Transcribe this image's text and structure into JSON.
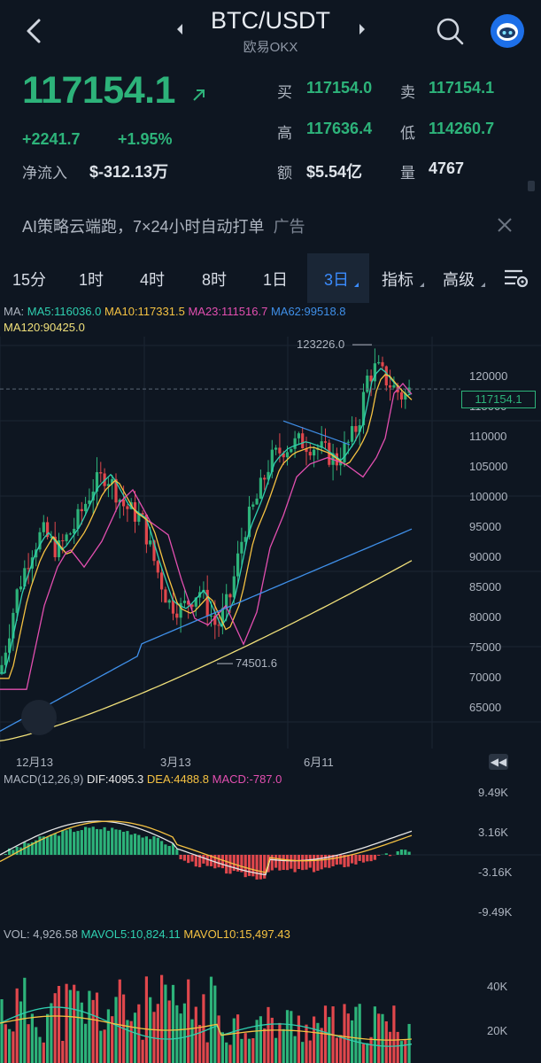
{
  "header": {
    "pair": "BTC/USDT",
    "exchange": "欧易OKX"
  },
  "ticker": {
    "price": "117154.1",
    "change_abs": "+2241.7",
    "change_pct": "+1.95%",
    "net_inflow_label": "净流入",
    "net_inflow_value": "$-312.13万",
    "buy_label": "买",
    "buy_value": "117154.0",
    "sell_label": "卖",
    "sell_value": "117154.1",
    "high_label": "高",
    "high_value": "117636.4",
    "low_label": "低",
    "low_value": "114260.7",
    "amount_label": "额",
    "amount_value": "$5.54亿",
    "volume_label": "量",
    "volume_value": "4767"
  },
  "ad": {
    "text": "AI策略云端跑，7×24小时自动打单",
    "tag": "广告"
  },
  "tabs": [
    {
      "label": "15分"
    },
    {
      "label": "1时"
    },
    {
      "label": "4时"
    },
    {
      "label": "8时"
    },
    {
      "label": "1日"
    },
    {
      "label": "3日"
    },
    {
      "label": "指标"
    },
    {
      "label": "高级"
    }
  ],
  "indicators": {
    "ma_label": "MA:",
    "ma5": "MA5:116036.0",
    "ma10": "MA10:117331.5",
    "ma23": "MA23:111516.7",
    "ma62": "MA62:99518.8",
    "ma120": "MA120:90425.0",
    "macd_title": "MACD(12,26,9)",
    "dif": "DIF:4095.3",
    "dea": "DEA:4488.8",
    "macd": "MACD:-787.0",
    "vol": "VOL: 4,926.58",
    "mavol5": "MAVOL5:10,824.11",
    "mavol10": "MAVOL10:15,497.43"
  },
  "colors": {
    "up": "#2db37a",
    "down": "#e0474c",
    "ma5": "#e6e6e6",
    "ma10": "#f5c242",
    "ma23": "#e24fb0",
    "ma62": "#3f8fe8",
    "ma120": "#f0e07a"
  },
  "chart_data": {
    "type": "candlestick",
    "interval": "3日",
    "y_ticks": [
      "120000",
      "115000",
      "110000",
      "105000",
      "100000",
      "95000",
      "90000",
      "85000",
      "80000",
      "75000",
      "70000",
      "65000"
    ],
    "x_ticks": [
      "12月13",
      "3月13",
      "6月11"
    ],
    "current_price": "117154.1",
    "max_label": "123226.0",
    "min_label": "74501.6",
    "macd_ticks": [
      "9.49K",
      "3.16K",
      "-3.16K",
      "-9.49K"
    ],
    "vol_ticks": [
      "40K",
      "20K"
    ]
  }
}
